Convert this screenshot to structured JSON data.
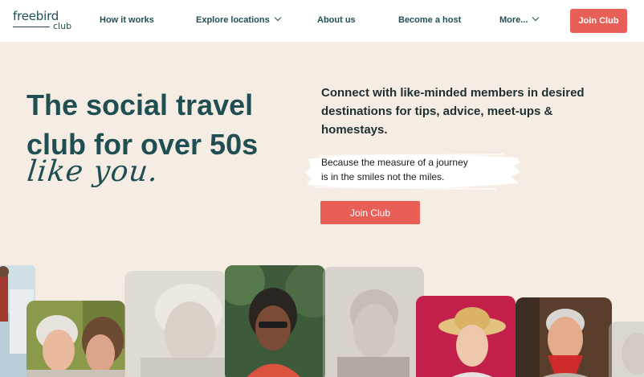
{
  "nav": {
    "logo_main": "freebird",
    "logo_sub": "club",
    "items": [
      {
        "label": "How it works"
      },
      {
        "label": "Explore locations"
      },
      {
        "label": "About us"
      },
      {
        "label": "Become a host"
      },
      {
        "label": "More..."
      }
    ],
    "join_label": "Join Club"
  },
  "hero": {
    "headline_line1": "The social travel",
    "headline_line2": "club for over 50s",
    "script": "like you.",
    "intro": "Connect with like-minded members in desired destinations for tips, advice, meet-ups & homestays.",
    "tagline_line1": "Because the measure of a journey",
    "tagline_line2": "is in the smiles not the miles.",
    "join_label": "Join Club"
  },
  "colors": {
    "accent": "#e85f57",
    "brand_teal": "#1f4f52",
    "background": "#f5ede3"
  },
  "icons": [
    "chevron-down-icon"
  ]
}
